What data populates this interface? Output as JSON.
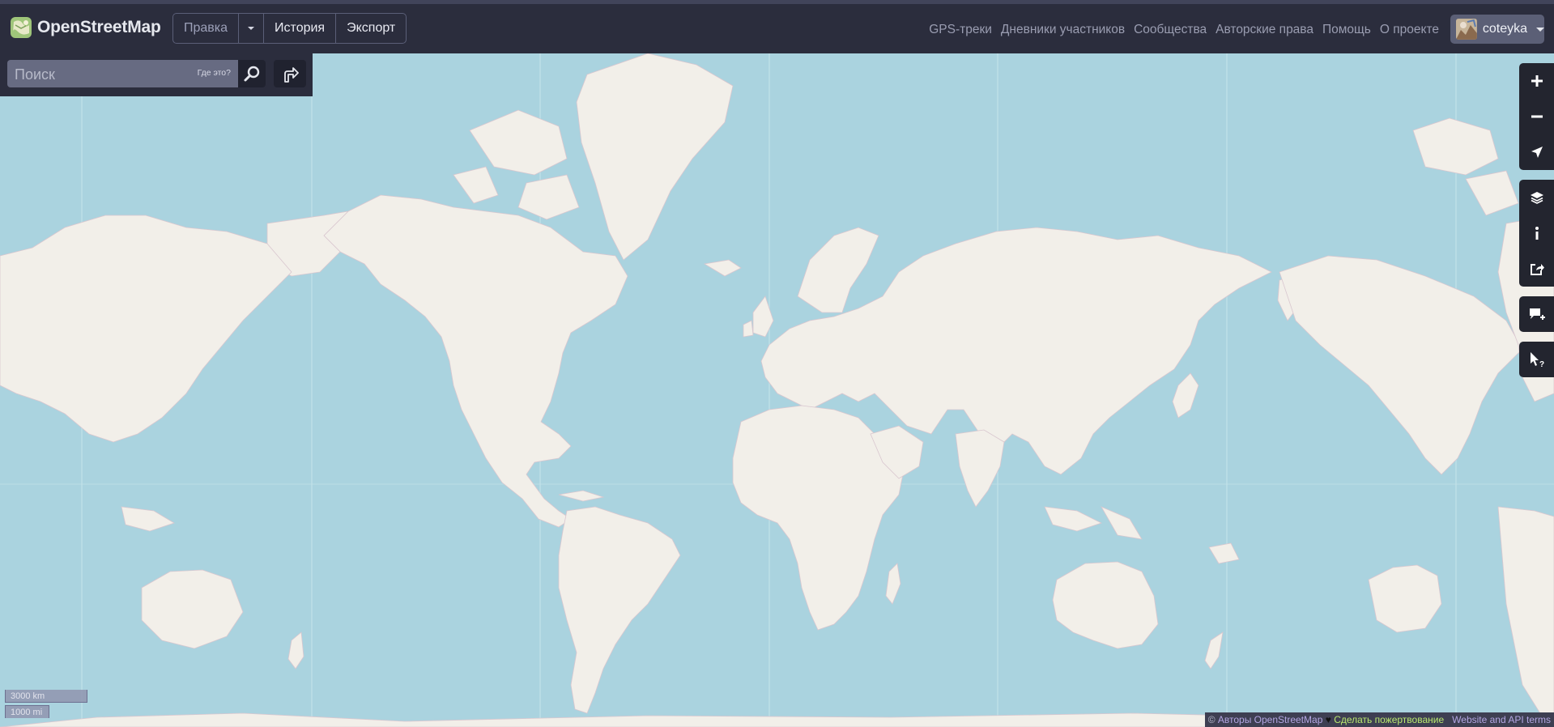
{
  "header": {
    "logo_text": "OpenStreetMap",
    "edit_label": "Правка",
    "history_label": "История",
    "export_label": "Экспорт",
    "nav": [
      {
        "label": "GPS-треки"
      },
      {
        "label": "Дневники участников"
      },
      {
        "label": "Сообщества"
      },
      {
        "label": "Авторские права"
      },
      {
        "label": "Помощь"
      },
      {
        "label": "О проекте"
      }
    ],
    "username": "coteyka"
  },
  "search": {
    "placeholder": "Поиск",
    "where_is_label": "Где это?"
  },
  "scale": {
    "km_label": "3000 km",
    "mi_label": "1000 mi"
  },
  "attribution": {
    "copyright": "©",
    "authors_label": "Авторы OpenStreetMap",
    "heart": "♥",
    "donate_label": "Сделать пожертвование",
    "terms_label": "Website and API terms"
  },
  "map_colors": {
    "water": "#aad3df",
    "land": "#f2efe9",
    "header_bg": "#2b2d3d"
  }
}
